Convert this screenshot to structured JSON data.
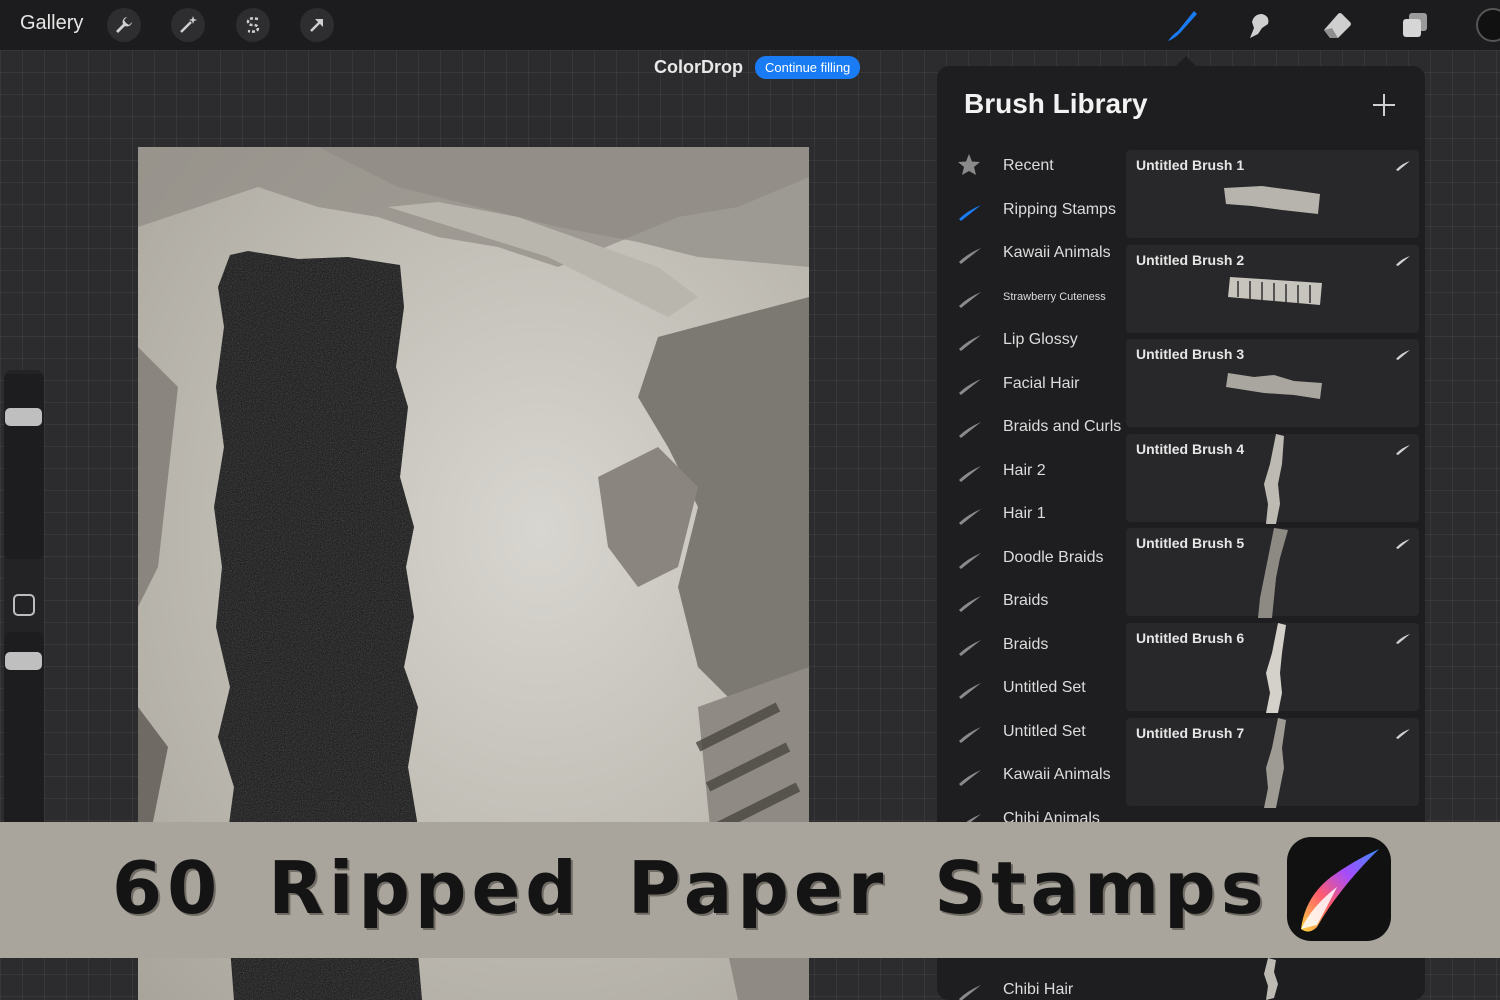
{
  "topbar": {
    "gallery_label": "Gallery",
    "left_tools": [
      "wrench-icon",
      "magic-wand-icon",
      "selection-s-icon",
      "transform-arrow-icon"
    ],
    "right_tools": [
      "brush-icon",
      "smudge-icon",
      "eraser-icon",
      "layers-icon"
    ],
    "active_tool": "brush-icon",
    "accent_color": "#1a7cf5"
  },
  "colordrop": {
    "title": "ColorDrop",
    "button_label": "Continue filling"
  },
  "brush_library": {
    "title": "Brush Library",
    "brush_sets": [
      {
        "label": "Recent",
        "icon": "star-icon"
      },
      {
        "label": "Ripping Stamps",
        "icon": "brush-set-icon",
        "active": true
      },
      {
        "label": "Kawaii Animals",
        "icon": "brush-set-icon"
      },
      {
        "label": "Strawberry Cuteness",
        "icon": "brush-set-icon",
        "small": true
      },
      {
        "label": "Lip Glossy",
        "icon": "brush-set-icon"
      },
      {
        "label": "Facial Hair",
        "icon": "brush-set-icon"
      },
      {
        "label": "Braids and Curls",
        "icon": "brush-set-icon"
      },
      {
        "label": "Hair 2",
        "icon": "brush-set-icon"
      },
      {
        "label": "Hair 1",
        "icon": "brush-set-icon"
      },
      {
        "label": "Doodle Braids",
        "icon": "brush-set-icon"
      },
      {
        "label": "Braids",
        "icon": "brush-set-icon"
      },
      {
        "label": "Braids",
        "icon": "brush-set-icon"
      },
      {
        "label": "Untitled Set",
        "icon": "brush-set-icon"
      },
      {
        "label": "Untitled Set",
        "icon": "brush-set-icon"
      },
      {
        "label": "Kawaii Animals",
        "icon": "brush-set-icon"
      },
      {
        "label": "Chibi Animals",
        "icon": "brush-set-icon"
      }
    ],
    "last_set": {
      "label": "Chibi Hair"
    },
    "brushes": [
      {
        "name": "Untitled Brush 1"
      },
      {
        "name": "Untitled Brush 2"
      },
      {
        "name": "Untitled Brush 3"
      },
      {
        "name": "Untitled Brush 4"
      },
      {
        "name": "Untitled Brush 5"
      },
      {
        "name": "Untitled Brush 6"
      },
      {
        "name": "Untitled Brush 7"
      }
    ]
  },
  "banner": {
    "headline": "60 Ripped Paper Stamps",
    "logo": "procreate-logo-icon"
  }
}
